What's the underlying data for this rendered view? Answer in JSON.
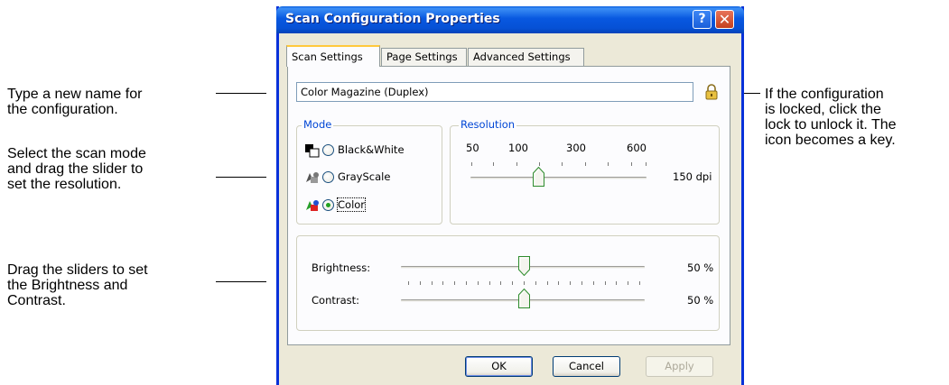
{
  "callouts": {
    "rename": [
      "Type a new name for",
      "the configuration."
    ],
    "mode": [
      "Select the scan mode",
      "and drag the slider to",
      "set the resolution."
    ],
    "sliders": [
      "Drag the sliders to set",
      "the Brightness and",
      "Contrast."
    ],
    "lock": [
      "If the configuration",
      "is locked, click the",
      "lock to unlock it. The",
      "icon becomes a key."
    ]
  },
  "window": {
    "title": "Scan Configuration Properties",
    "help_label": "?",
    "close_label": "✕"
  },
  "tabs": [
    {
      "label": "Scan Settings",
      "active": true
    },
    {
      "label": "Page Settings",
      "active": false
    },
    {
      "label": "Advanced Settings",
      "active": false
    }
  ],
  "config_name": {
    "value": "Color Magazine (Duplex)",
    "locked": true
  },
  "mode": {
    "title": "Mode",
    "options": [
      {
        "label": "Black&White",
        "icon": "black-white-mode-icon",
        "selected": false
      },
      {
        "label": "GrayScale",
        "icon": "grayscale-mode-icon",
        "selected": false
      },
      {
        "label": "Color",
        "icon": "color-mode-icon",
        "selected": true
      }
    ]
  },
  "resolution": {
    "title": "Resolution",
    "scale_labels": [
      "50",
      "100",
      "300",
      "600"
    ],
    "value_text": "150 dpi"
  },
  "adjustments": {
    "brightness": {
      "label": "Brightness:",
      "value_text": "50 %",
      "level": 0.5
    },
    "contrast": {
      "label": "Contrast:",
      "value_text": "50 %",
      "level": 0.5
    }
  },
  "buttons": {
    "ok": "OK",
    "cancel": "Cancel",
    "apply": "Apply"
  },
  "colors": {
    "titlebar": "#0851d6",
    "dialog_bg": "#ece9d8",
    "group_title": "#0046d5"
  }
}
